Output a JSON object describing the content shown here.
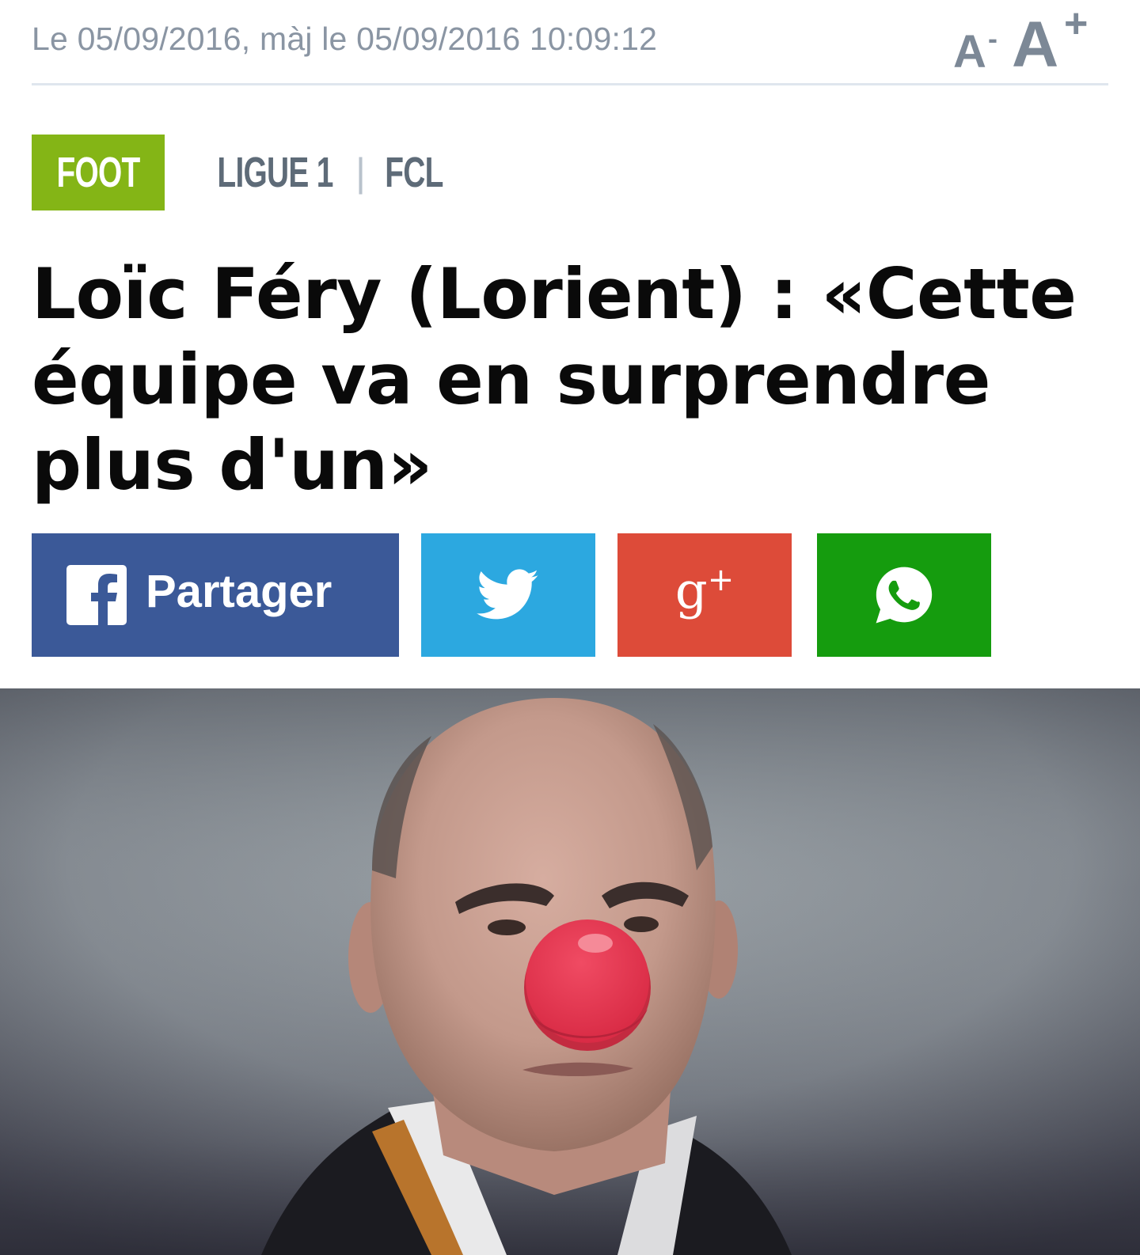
{
  "meta": {
    "date_text": "Le 05/09/2016, màj le 05/09/2016 10:09:12",
    "font_decrease": "A",
    "font_decrease_sign": "-",
    "font_increase": "A",
    "font_increase_sign": "+"
  },
  "categories": {
    "primary": "FOOT",
    "links": [
      "LIGUE 1",
      "FCL"
    ],
    "separator": "|"
  },
  "article": {
    "headline": "Loïc Féry (Lorient) : «Cette équipe va en surprendre plus d'un»"
  },
  "share": {
    "facebook_label": "Partager",
    "gplus_label": "g",
    "gplus_sup": "+",
    "icons": [
      "facebook-icon",
      "twitter-icon",
      "google-plus-icon",
      "whatsapp-icon"
    ],
    "colors": {
      "facebook": "#3b5998",
      "twitter": "#2ca8e0",
      "gplus": "#dd4b39",
      "whatsapp": "#159c0e"
    }
  },
  "colors": {
    "category_badge": "#84b516",
    "meta_text": "#8a95a3",
    "headline": "#0a0a0a",
    "clown_nose": "#e8344e"
  }
}
